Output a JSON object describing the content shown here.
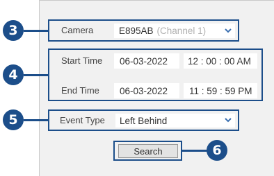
{
  "camera": {
    "label": "Camera",
    "value": "E895AB",
    "channel": "(Channel 1)",
    "dropdown_icon": "chevron-down-icon"
  },
  "start_time": {
    "label": "Start Time",
    "date": "06-03-2022",
    "time": "12 : 00 : 00 AM"
  },
  "end_time": {
    "label": "End Time",
    "date": "06-03-2022",
    "time": "11 : 59 : 59 PM"
  },
  "event_type": {
    "label": "Event Type",
    "value": "Left Behind",
    "dropdown_icon": "chevron-down-icon"
  },
  "search_button": {
    "label": "Search"
  },
  "callouts": {
    "camera": "3",
    "time_range": "4",
    "event_type": "5",
    "search": "6"
  },
  "colors": {
    "accent": "#1c4e8a",
    "panel": "#f1f1f1",
    "field": "#ffffff",
    "chevron": "#3a6fb0"
  }
}
